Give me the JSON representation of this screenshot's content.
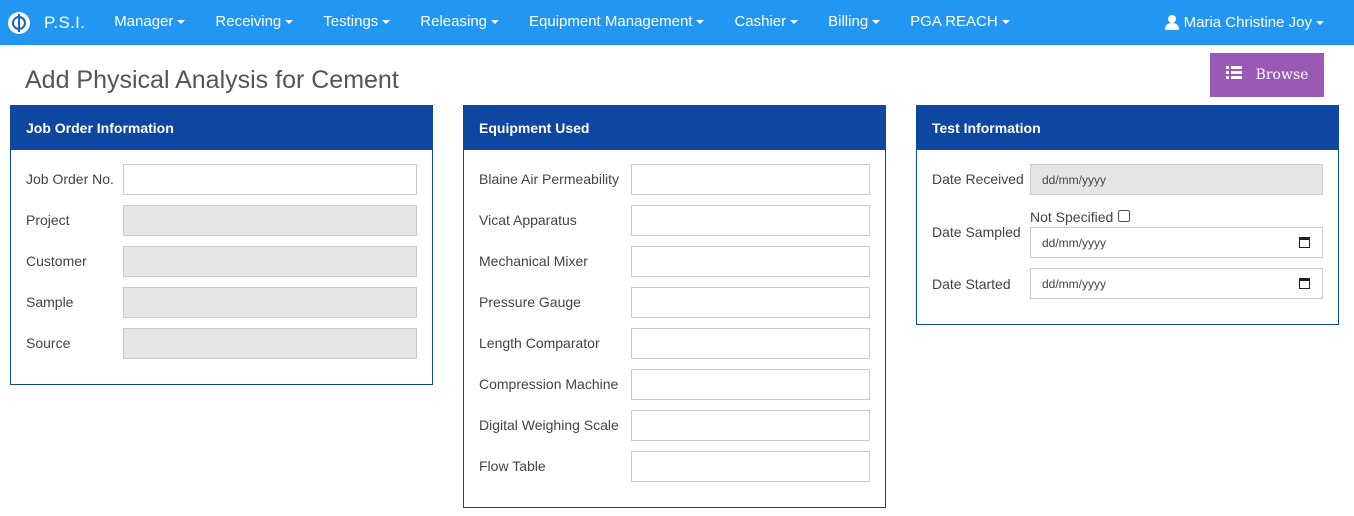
{
  "navbar": {
    "brand": "P.S.I.",
    "items": [
      "Manager",
      "Receiving",
      "Testings",
      "Releasing",
      "Equipment Management",
      "Cashier",
      "Billing",
      "PGA REACH"
    ],
    "user": "Maria Christine Joy"
  },
  "page": {
    "title": "Add Physical Analysis for Cement",
    "browse_label": "Browse"
  },
  "job_order": {
    "heading": "Job Order Information",
    "fields": [
      {
        "label": "Job Order No.",
        "value": "",
        "readonly": false
      },
      {
        "label": "Project",
        "value": "",
        "readonly": true
      },
      {
        "label": "Customer",
        "value": "",
        "readonly": true
      },
      {
        "label": "Sample",
        "value": "",
        "readonly": true
      },
      {
        "label": "Source",
        "value": "",
        "readonly": true
      }
    ]
  },
  "equipment": {
    "heading": "Equipment Used",
    "fields": [
      {
        "label": "Blaine Air Permeability",
        "value": ""
      },
      {
        "label": "Vicat Apparatus",
        "value": ""
      },
      {
        "label": "Mechanical Mixer",
        "value": ""
      },
      {
        "label": "Pressure Gauge",
        "value": ""
      },
      {
        "label": "Length Comparator",
        "value": ""
      },
      {
        "label": "Compression Machine",
        "value": ""
      },
      {
        "label": "Digital Weighing Scale",
        "value": ""
      },
      {
        "label": "Flow Table",
        "value": ""
      }
    ]
  },
  "test_info": {
    "heading": "Test Information",
    "date_received": {
      "label": "Date Received",
      "placeholder": "dd/mm/yyyy"
    },
    "date_sampled": {
      "label": "Date Sampled",
      "placeholder": "dd/mm/yyyy",
      "not_specified_label": "Not Specified"
    },
    "date_started": {
      "label": "Date Started",
      "placeholder": "dd/mm/yyyy"
    }
  },
  "colors": {
    "navbar": "#2196f3",
    "panel_header": "#0d47a1",
    "browse_button": "#9b59b6"
  }
}
